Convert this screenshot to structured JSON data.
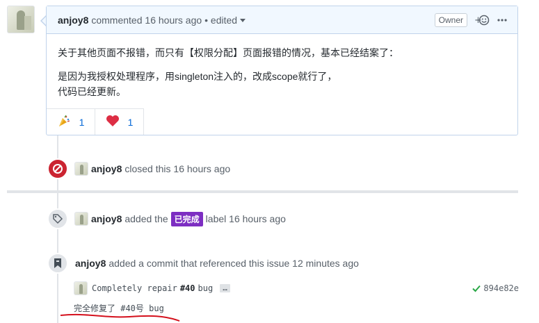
{
  "comment": {
    "author": "anjoy8",
    "action": "commented",
    "time": "16 hours ago",
    "edited": "• edited",
    "owner_badge": "Owner",
    "body": {
      "line1": "关于其他页面不报错，而只有【权限分配】页面报错的情况，基本已经结案了：",
      "line2": "是因为我授权处理程序，用singleton注入的，改成scope就行了，",
      "line3": "代码已经更新。"
    },
    "reactions": [
      {
        "emoji": "tada",
        "count": "1"
      },
      {
        "emoji": "heart",
        "count": "1"
      }
    ]
  },
  "closed_event": {
    "author": "anjoy8",
    "text": "closed this",
    "time": "16 hours ago"
  },
  "label_event": {
    "author": "anjoy8",
    "text": "added the",
    "label": "已完成",
    "label_color": "#7d2ec2",
    "suffix": "label",
    "time": "16 hours ago"
  },
  "commit_event": {
    "author": "anjoy8",
    "text": "added a commit that referenced this issue",
    "time": "12 minutes ago",
    "commit_msg_prefix": "Completely repair",
    "commit_msg_ref": "#40",
    "commit_msg_suffix": "bug",
    "expander": "…",
    "sha": "894e82e",
    "description": "完全修复了 #40号 bug"
  },
  "colors": {
    "closed_badge": "#cb2431",
    "event_badge": "#e1e4e8",
    "link": "#0366d6",
    "check": "#28a745",
    "annotation_underline": "#d4101c"
  }
}
